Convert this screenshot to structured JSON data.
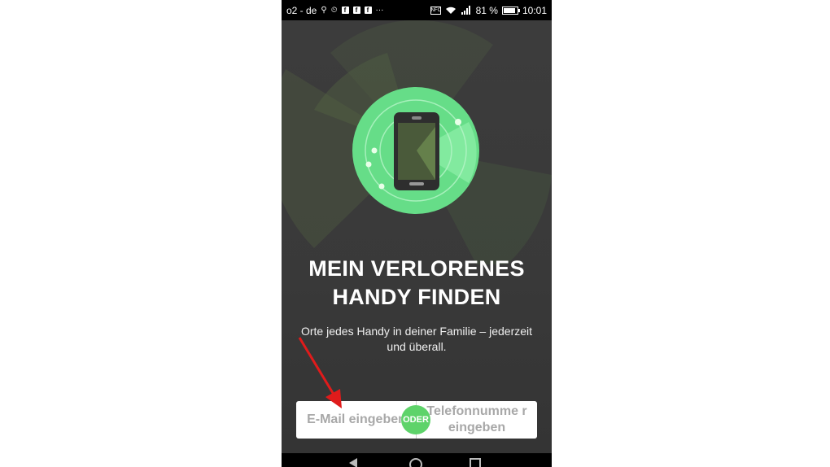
{
  "status_bar": {
    "carrier": "o2 - de",
    "nfc": "NFC",
    "battery_percent": "81 %",
    "time": "10:01"
  },
  "hero": {
    "title": "MEIN VERLORENES HANDY FINDEN",
    "subtitle": "Orte jedes Handy in deiner Familie – jederzeit und überall."
  },
  "choice": {
    "email_label": "E-Mail eingeben",
    "or_label": "ODER",
    "phone_label": "Telefonnumme r eingeben"
  },
  "colors": {
    "accent_green": "#5ed36a",
    "background": "#3a3a3a",
    "annotation_arrow": "#e01b1b"
  },
  "icons": [
    "location-icon",
    "alarm-icon",
    "facebook-icon",
    "more-icon",
    "nfc-icon",
    "wifi-icon",
    "signal-icon",
    "battery-icon",
    "back-icon",
    "home-icon",
    "recents-icon",
    "phone-radar-icon"
  ]
}
